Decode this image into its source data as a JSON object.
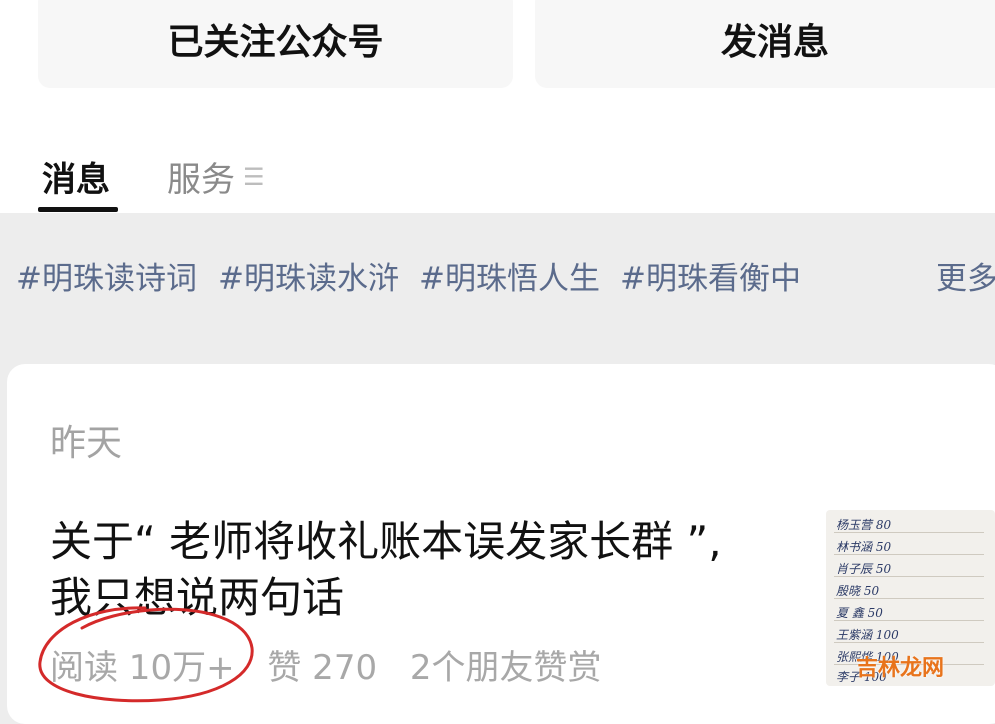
{
  "header": {
    "follow_button": "已关注公众号",
    "message_button": "发消息"
  },
  "tabs": [
    {
      "label": "消息",
      "active": true
    },
    {
      "label": "服务",
      "icon": "menu-icon"
    }
  ],
  "tags": [
    "#明珠读诗词",
    "#明珠读水浒",
    "#明珠悟人生",
    "#明珠看衡中"
  ],
  "more_label": "更多",
  "article": {
    "date": "昨天",
    "title_line1": "关于“ 老师将收礼账本误发家长群 ”,",
    "title_line2": "我只想说两句话",
    "reads": "阅读 10万+",
    "likes": "赞 270",
    "friends": "2个朋友赞赏",
    "thumbnail_icon": "handwritten-ledger-image"
  },
  "thumbnail": {
    "lines": [
      "杨玉营 80",
      "林书涵 50",
      "肖子辰 50",
      "殷晓 50",
      "夏 鑫 50",
      "王紫涵 100",
      "张熙烨 100",
      "李子 100"
    ],
    "watermark": "吉林龙网"
  },
  "colors": {
    "accent_tag": "#5b6b8c",
    "annotation": "#d42a2a",
    "watermark": "#e8741c"
  }
}
